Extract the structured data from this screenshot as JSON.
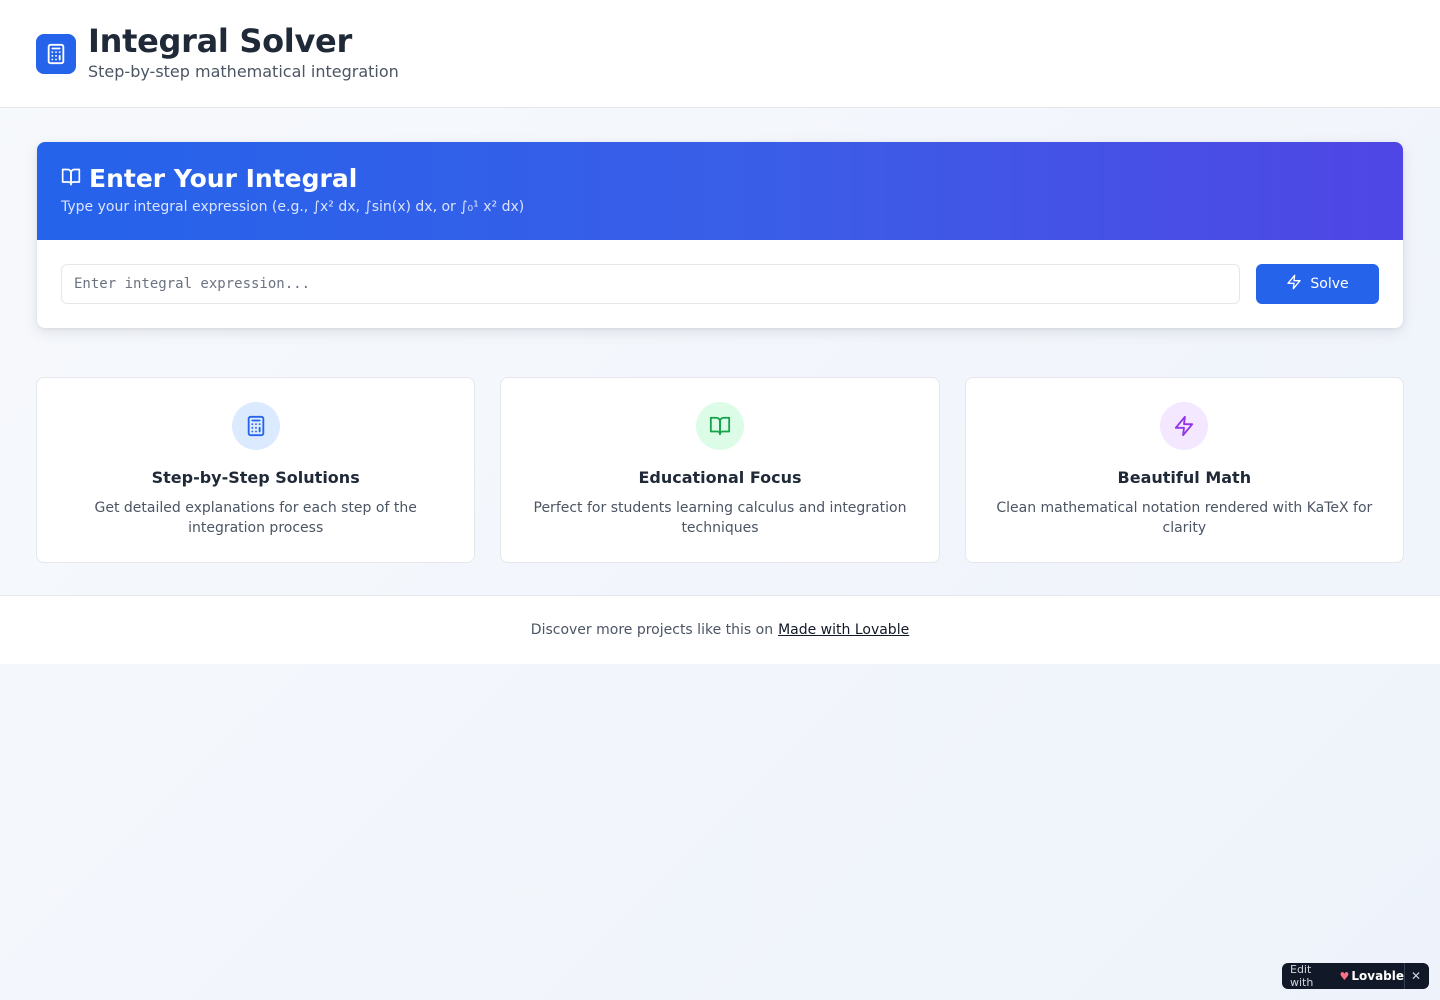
{
  "header": {
    "title": "Integral Solver",
    "subtitle": "Step-by-step mathematical integration",
    "logo_icon": "calculator-icon"
  },
  "input_card": {
    "title": "Enter Your Integral",
    "title_icon": "book-open-icon",
    "description": "Type your integral expression (e.g., ∫x² dx, ∫sin(x) dx, or ∫₀¹ x² dx)",
    "input": {
      "value": "",
      "placeholder": "Enter integral expression..."
    },
    "solve_label": "Solve",
    "solve_icon": "zap-icon"
  },
  "features": [
    {
      "icon": "calculator-icon",
      "title": "Step-by-Step Solutions",
      "description": "Get detailed explanations for each step of the integration process"
    },
    {
      "icon": "book-open-icon",
      "title": "Educational Focus",
      "description": "Perfect for students learning calculus and integration techniques"
    },
    {
      "icon": "zap-icon",
      "title": "Beautiful Math",
      "description": "Clean mathematical notation rendered with KaTeX for clarity"
    }
  ],
  "footer": {
    "text": "Discover more projects like this on",
    "link_label": "Made with Lovable"
  },
  "badge": {
    "edit_label": "Edit with",
    "brand": "Lovable",
    "close_label": "✕"
  },
  "colors": {
    "primary": "#2563eb",
    "gradient_end": "#4f46e5",
    "green_icon": "#16a34a",
    "purple_icon": "#9333ea"
  }
}
